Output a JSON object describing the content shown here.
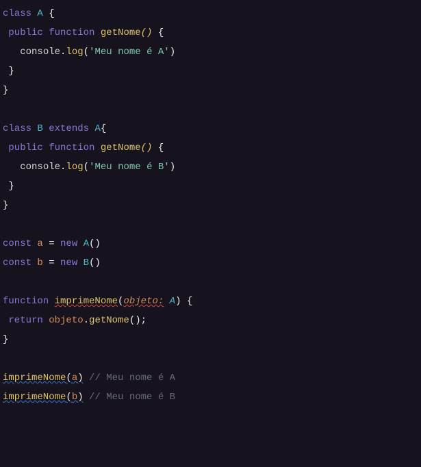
{
  "tokens": [
    [
      {
        "t": "class ",
        "c": "tok-kw"
      },
      {
        "t": "A ",
        "c": "tok-class"
      },
      {
        "t": "{",
        "c": "tok-brace"
      }
    ],
    [
      {
        "t": " ",
        "c": ""
      },
      {
        "t": "public ",
        "c": "tok-kw"
      },
      {
        "t": "function ",
        "c": "tok-kw"
      },
      {
        "t": "getNome",
        "c": "tok-method"
      },
      {
        "t": "()",
        "c": "tok-methodI"
      },
      {
        "t": " {",
        "c": "tok-brace"
      }
    ],
    [
      {
        "t": "   ",
        "c": ""
      },
      {
        "t": "console",
        "c": "tok-prop"
      },
      {
        "t": ".",
        "c": "tok-punct"
      },
      {
        "t": "log",
        "c": "tok-method"
      },
      {
        "t": "(",
        "c": "tok-punct"
      },
      {
        "t": "'Meu nome é A'",
        "c": "tok-str"
      },
      {
        "t": ")",
        "c": "tok-punct"
      }
    ],
    [
      {
        "t": " }",
        "c": "tok-brace"
      }
    ],
    [
      {
        "t": "}",
        "c": "tok-brace"
      }
    ],
    [],
    [
      {
        "t": "class ",
        "c": "tok-kw"
      },
      {
        "t": "B ",
        "c": "tok-class"
      },
      {
        "t": "extends ",
        "c": "tok-kw"
      },
      {
        "t": "A",
        "c": "tok-class"
      },
      {
        "t": "{",
        "c": "tok-brace"
      }
    ],
    [
      {
        "t": " ",
        "c": ""
      },
      {
        "t": "public ",
        "c": "tok-kw"
      },
      {
        "t": "function ",
        "c": "tok-kw"
      },
      {
        "t": "getNome",
        "c": "tok-method"
      },
      {
        "t": "()",
        "c": "tok-methodI"
      },
      {
        "t": " {",
        "c": "tok-brace"
      }
    ],
    [
      {
        "t": "   ",
        "c": ""
      },
      {
        "t": "console",
        "c": "tok-prop"
      },
      {
        "t": ".",
        "c": "tok-punct"
      },
      {
        "t": "log",
        "c": "tok-method"
      },
      {
        "t": "(",
        "c": "tok-punct"
      },
      {
        "t": "'Meu nome é B'",
        "c": "tok-str"
      },
      {
        "t": ")",
        "c": "tok-punct"
      }
    ],
    [
      {
        "t": " }",
        "c": "tok-brace"
      }
    ],
    [
      {
        "t": "}",
        "c": "tok-brace"
      }
    ],
    [],
    [
      {
        "t": "const ",
        "c": "tok-kw"
      },
      {
        "t": "a ",
        "c": "tok-var"
      },
      {
        "t": "= ",
        "c": "tok-punct"
      },
      {
        "t": "new ",
        "c": "tok-kw"
      },
      {
        "t": "A",
        "c": "tok-class"
      },
      {
        "t": "()",
        "c": "tok-punct"
      }
    ],
    [
      {
        "t": "const ",
        "c": "tok-kw"
      },
      {
        "t": "b ",
        "c": "tok-var"
      },
      {
        "t": "= ",
        "c": "tok-punct"
      },
      {
        "t": "new ",
        "c": "tok-kw"
      },
      {
        "t": "B",
        "c": "tok-class"
      },
      {
        "t": "()",
        "c": "tok-punct"
      }
    ],
    [],
    [
      {
        "t": "function ",
        "c": "tok-kw"
      },
      {
        "t": "imprimeNome",
        "c": "tok-fn wavy-red"
      },
      {
        "t": "(",
        "c": "tok-punct"
      },
      {
        "t": "objeto:",
        "c": "tok-param wavy-red"
      },
      {
        "t": " ",
        "c": ""
      },
      {
        "t": "A",
        "c": "tok-paramT"
      },
      {
        "t": ")",
        "c": "tok-punct"
      },
      {
        "t": " {",
        "c": "tok-brace"
      }
    ],
    [
      {
        "t": " ",
        "c": ""
      },
      {
        "t": "return ",
        "c": "tok-kw"
      },
      {
        "t": "objeto",
        "c": "tok-var"
      },
      {
        "t": ".",
        "c": "tok-punct"
      },
      {
        "t": "getNome",
        "c": "tok-method"
      },
      {
        "t": "();",
        "c": "tok-punct"
      }
    ],
    [
      {
        "t": "}",
        "c": "tok-brace"
      }
    ],
    [],
    [
      {
        "t": "imprimeNome",
        "c": "tok-fn wavy-blue"
      },
      {
        "t": "(",
        "c": "tok-punct wavy-blue"
      },
      {
        "t": "a",
        "c": "tok-var wavy-blue"
      },
      {
        "t": ")",
        "c": "tok-punct wavy-blue"
      },
      {
        "t": " ",
        "c": ""
      },
      {
        "t": "// Meu nome é A",
        "c": "tok-comment"
      }
    ],
    [
      {
        "t": "imprimeNome",
        "c": "tok-fn wavy-blue"
      },
      {
        "t": "(",
        "c": "tok-punct wavy-blue"
      },
      {
        "t": "b",
        "c": "tok-var wavy-blue"
      },
      {
        "t": ")",
        "c": "tok-punct wavy-blue"
      },
      {
        "t": " ",
        "c": ""
      },
      {
        "t": "// Meu nome é B",
        "c": "tok-comment"
      }
    ]
  ]
}
